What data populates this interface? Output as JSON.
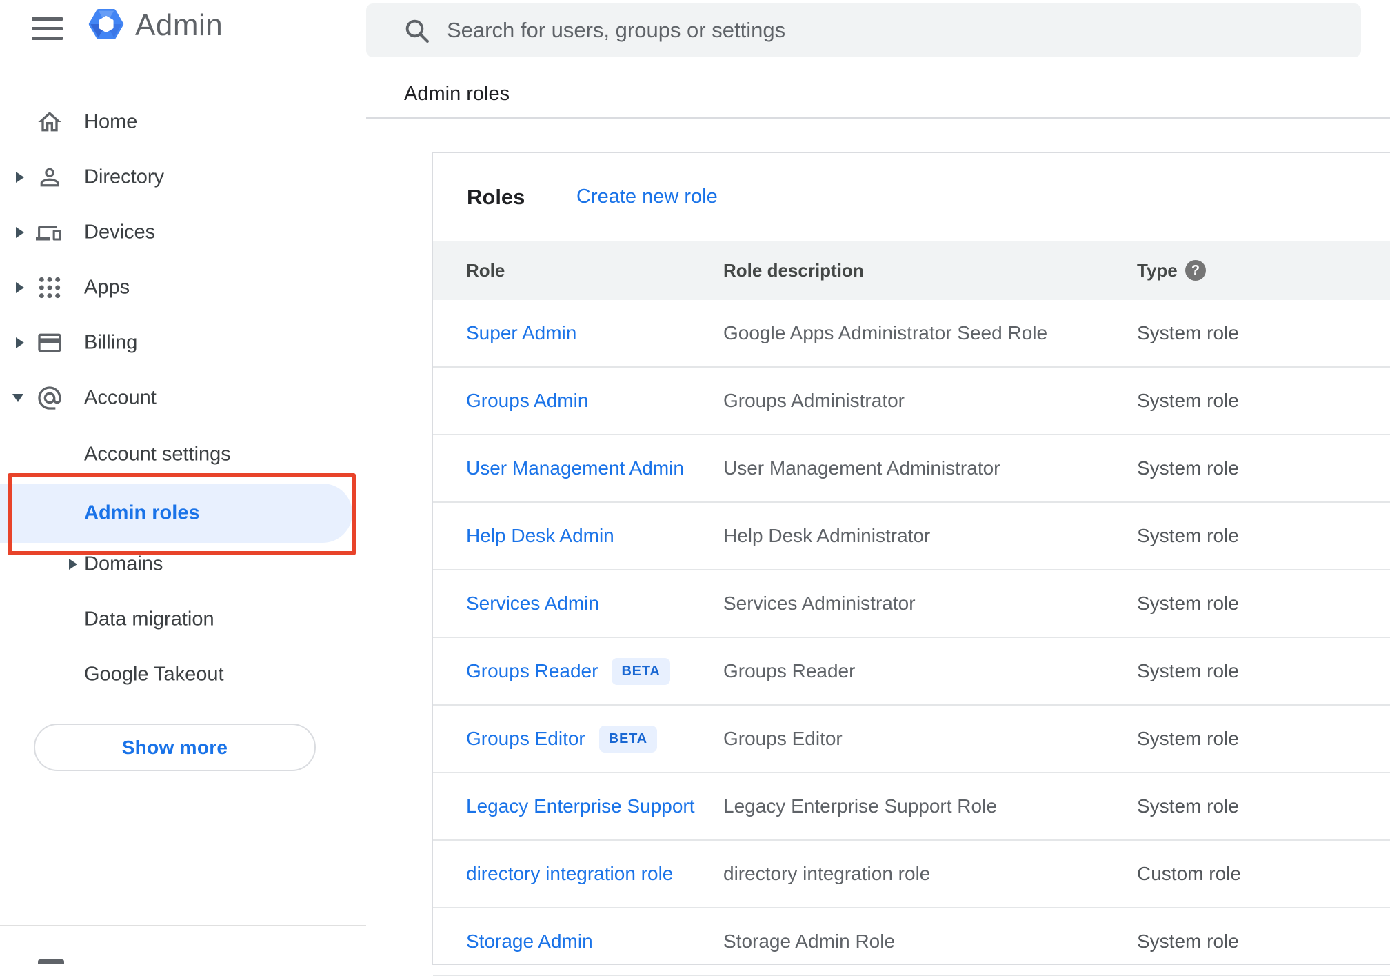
{
  "app": {
    "name": "Admin"
  },
  "topbar": {
    "search_placeholder": "Search for users, groups or settings"
  },
  "breadcrumb": "Admin roles",
  "sidebar": {
    "items": [
      {
        "label": "Home",
        "icon": "home-icon",
        "expand": null,
        "sub": false,
        "selected": false
      },
      {
        "label": "Directory",
        "icon": "directory-icon",
        "expand": "collapsed",
        "sub": false,
        "selected": false
      },
      {
        "label": "Devices",
        "icon": "devices-icon",
        "expand": "collapsed",
        "sub": false,
        "selected": false
      },
      {
        "label": "Apps",
        "icon": "apps-icon",
        "expand": "collapsed",
        "sub": false,
        "selected": false
      },
      {
        "label": "Billing",
        "icon": "billing-icon",
        "expand": "collapsed",
        "sub": false,
        "selected": false
      },
      {
        "label": "Account",
        "icon": "account-icon",
        "expand": "expanded",
        "sub": false,
        "selected": false
      },
      {
        "label": "Account settings",
        "icon": null,
        "expand": null,
        "sub": true,
        "selected": false
      },
      {
        "label": "Admin roles",
        "icon": null,
        "expand": null,
        "sub": true,
        "selected": true,
        "annotated": true
      },
      {
        "label": "Domains",
        "icon": null,
        "expand": "collapsed",
        "sub": true,
        "selected": false
      },
      {
        "label": "Data migration",
        "icon": null,
        "expand": null,
        "sub": true,
        "selected": false
      },
      {
        "label": "Google Takeout",
        "icon": null,
        "expand": null,
        "sub": true,
        "selected": false
      }
    ],
    "show_more_label": "Show more"
  },
  "main": {
    "card": {
      "title": "Roles",
      "create_link": "Create new role",
      "columns": [
        "Role",
        "Role description",
        "Type"
      ],
      "rows": [
        {
          "role": "Super Admin",
          "beta": false,
          "beta_label": "",
          "description": "Google Apps Administrator Seed Role",
          "type": "System role"
        },
        {
          "role": "Groups Admin",
          "beta": false,
          "beta_label": "",
          "description": "Groups Administrator",
          "type": "System role"
        },
        {
          "role": "User Management Admin",
          "beta": false,
          "beta_label": "",
          "description": "User Management Administrator",
          "type": "System role"
        },
        {
          "role": "Help Desk Admin",
          "beta": false,
          "beta_label": "",
          "description": "Help Desk Administrator",
          "type": "System role"
        },
        {
          "role": "Services Admin",
          "beta": false,
          "beta_label": "",
          "description": "Services Administrator",
          "type": "System role"
        },
        {
          "role": "Groups Reader",
          "beta": true,
          "beta_label": "BETA",
          "description": "Groups Reader",
          "type": "System role"
        },
        {
          "role": "Groups Editor",
          "beta": true,
          "beta_label": "BETA",
          "description": "Groups Editor",
          "type": "System role"
        },
        {
          "role": "Legacy Enterprise Support",
          "beta": false,
          "beta_label": "",
          "description": "Legacy Enterprise Support Role",
          "type": "System role"
        },
        {
          "role": "directory integration role",
          "beta": false,
          "beta_label": "",
          "description": "directory integration role",
          "type": "Custom role"
        },
        {
          "role": "Storage Admin",
          "beta": false,
          "beta_label": "",
          "description": "Storage Admin Role",
          "type": "System role"
        }
      ]
    },
    "help_icon_glyph": "?"
  },
  "colors": {
    "accent_blue": "#1a73e8",
    "selected_item_bg": "#e8f0fe",
    "annotation_red": "#e8432a",
    "table_header_bg": "#f1f3f4",
    "beta_badge_bg": "#e8f0fe",
    "beta_badge_text": "#1967d2",
    "icon_gray": "#5f6368",
    "logo_blue": "#4285f4"
  }
}
